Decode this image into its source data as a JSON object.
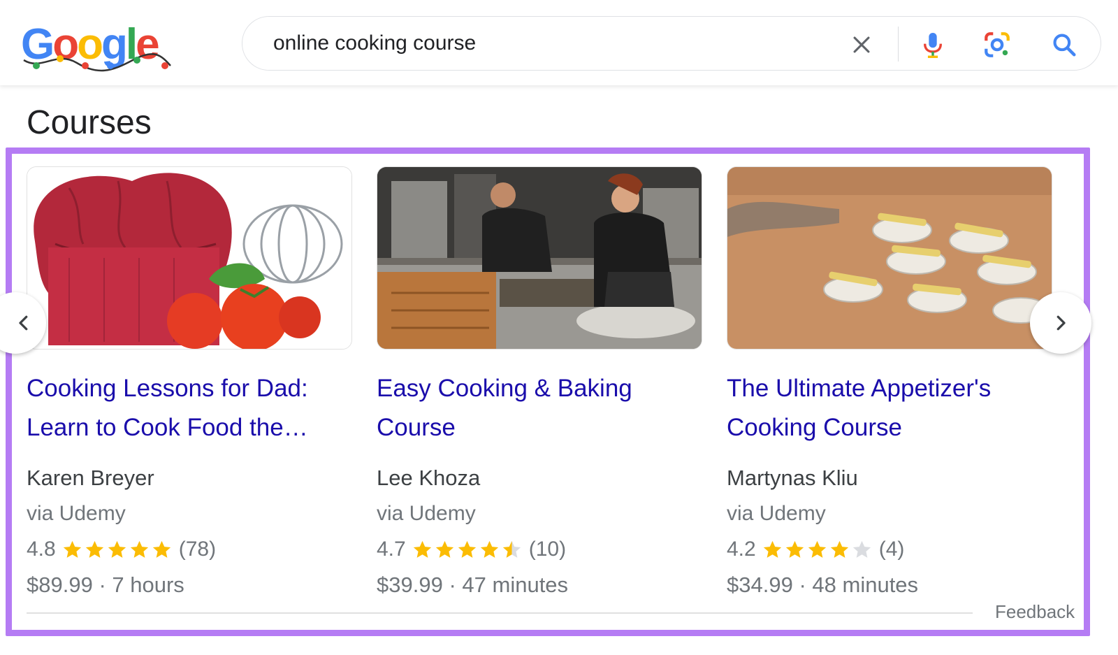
{
  "logo": {
    "text": "Google",
    "colors": [
      "#4285F4",
      "#EA4335",
      "#FBBC05",
      "#4285F4",
      "#34A853",
      "#EA4335"
    ]
  },
  "search": {
    "query": "online cooking course",
    "icons": [
      "close-icon",
      "microphone-icon",
      "google-lens-icon",
      "search-icon"
    ]
  },
  "section_title": "Courses",
  "cards": [
    {
      "title_line1": "Cooking Lessons for Dad:",
      "title_line2": "Learn to Cook Food the…",
      "author": "Karen Breyer",
      "provider": "via Udemy",
      "rating": "4.8",
      "rating_value": 4.8,
      "reviews": "(78)",
      "price": "$89.99",
      "duration": "7 hours",
      "image": "chef-hat-tomatoes-whisk"
    },
    {
      "title_line1": "Easy Cooking & Baking",
      "title_line2": "Course",
      "author": "Lee Khoza",
      "provider": "via Udemy",
      "rating": "4.7",
      "rating_value": 4.7,
      "reviews": "(10)",
      "price": "$39.99",
      "duration": "47 minutes",
      "image": "two-chefs-in-kitchen"
    },
    {
      "title_line1": "The Ultimate Appetizer's",
      "title_line2": "Cooking Course",
      "author": "Martynas Kliu",
      "provider": "via Udemy",
      "rating": "4.2",
      "rating_value": 4.2,
      "reviews": "(4)",
      "price": "$34.99",
      "duration": "48 minutes",
      "image": "appetizers-on-wooden-board"
    }
  ],
  "price_separator": "·",
  "feedback": "Feedback",
  "colors": {
    "link": "#1a0dab",
    "star": "#fbbc04",
    "star_empty": "#dadce0",
    "highlight_frame": "#b57cf4",
    "secondary_text": "#70757a"
  }
}
